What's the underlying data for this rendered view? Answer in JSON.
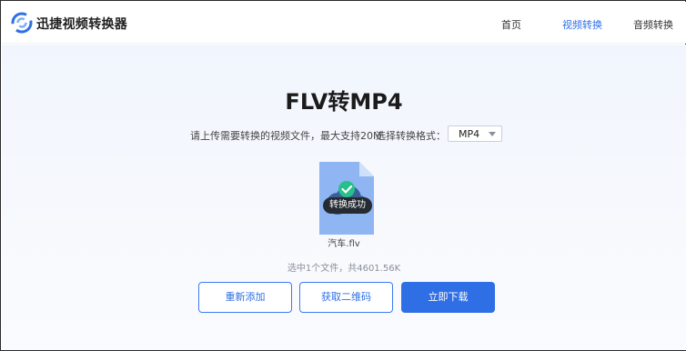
{
  "header": {
    "brand": "迅捷视频转换器",
    "nav": [
      {
        "label": "首页",
        "active": false
      },
      {
        "label": "视频转换",
        "active": true
      },
      {
        "label": "音频转换",
        "active": false
      }
    ]
  },
  "main": {
    "title": "FLV转MP4",
    "hint": "请上传需要转换的视频文件，最大支持20M",
    "format_label": "选择转换格式：",
    "format_value": "MP4",
    "status_badge": "转换成功",
    "file_name": "汽车.flv",
    "summary": "选中1个文件，共4601.56K",
    "buttons": {
      "re_add": "重新添加",
      "qr_code": "获取二维码",
      "download": "立即下载"
    }
  },
  "icons": {
    "logo": "brand-logo-icon",
    "file": "document-icon",
    "success": "check-circle-icon",
    "cloud": "cloud-icon",
    "dropdown": "chevron-down-icon"
  },
  "colors": {
    "accent": "#2f6fe6",
    "success": "#27c08a",
    "badge_bg": "#262b33",
    "file_icon": "#8fb6f2"
  }
}
